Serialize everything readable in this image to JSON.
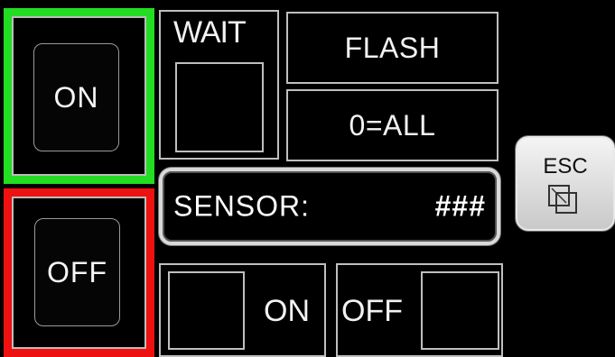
{
  "buttons": {
    "on": {
      "label": "ON",
      "frame_color": "#22dd22"
    },
    "off": {
      "label": "OFF",
      "frame_color": "#ee1111"
    }
  },
  "wait": {
    "label": "WAIT"
  },
  "flash": {
    "label": "FLASH"
  },
  "all": {
    "label": "0=ALL"
  },
  "sensor": {
    "label": "SENSOR:",
    "value": "###"
  },
  "esc": {
    "label": "ESC",
    "icon": "overlapping-squares-icon"
  },
  "bottom": {
    "on_label": "ON",
    "off_label": "OFF"
  }
}
